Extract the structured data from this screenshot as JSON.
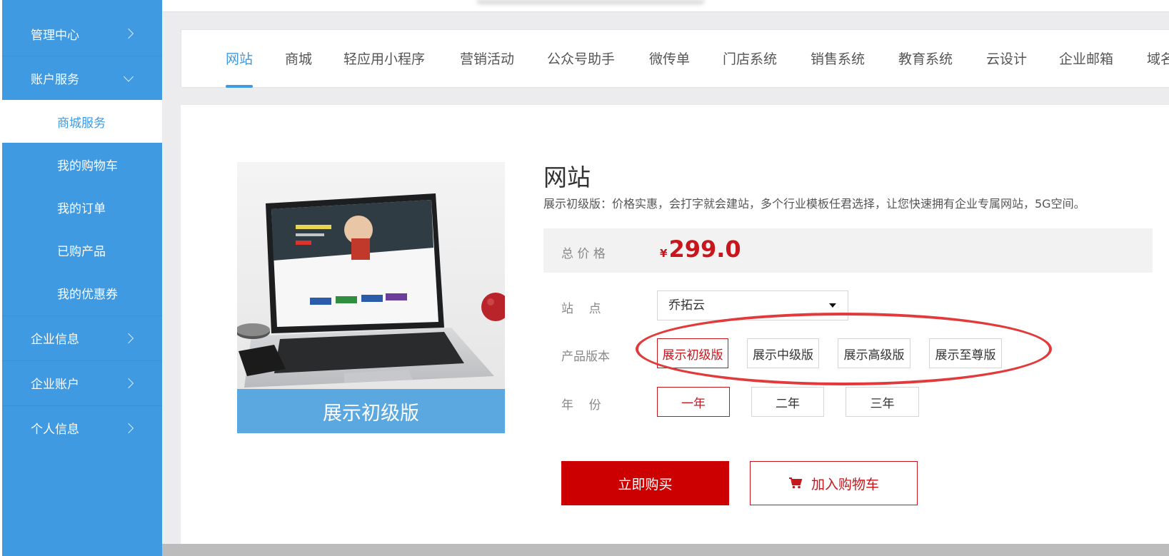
{
  "sidebar": {
    "items": [
      {
        "label": "管理中心"
      },
      {
        "label": "账户服务"
      },
      {
        "label": "企业信息"
      },
      {
        "label": "企业账户"
      },
      {
        "label": "个人信息"
      }
    ],
    "sub_items": [
      {
        "label": "商城服务"
      },
      {
        "label": "我的购物车"
      },
      {
        "label": "我的订单"
      },
      {
        "label": "已购产品"
      },
      {
        "label": "我的优惠券"
      }
    ]
  },
  "tabs": [
    {
      "label": "网站"
    },
    {
      "label": "商城"
    },
    {
      "label": "轻应用小程序"
    },
    {
      "label": "营销活动"
    },
    {
      "label": "公众号助手"
    },
    {
      "label": "微传单"
    },
    {
      "label": "门店系统"
    },
    {
      "label": "销售系统"
    },
    {
      "label": "教育系统"
    },
    {
      "label": "云设计"
    },
    {
      "label": "企业邮箱"
    },
    {
      "label": "域名"
    }
  ],
  "product": {
    "title": "网站",
    "description": "展示初级版：价格实惠，会打字就会建站，多个行业模板任君选择，让您快速拥有企业专属网站，5G空间。",
    "image_caption": "展示初级版",
    "price_label": "总 价 格",
    "currency": "¥",
    "price": "299.0",
    "site_label": "站    点",
    "site_value": "乔拓云",
    "version_label": "产品版本",
    "versions": [
      {
        "label": "展示初级版"
      },
      {
        "label": "展示中级版"
      },
      {
        "label": "展示高级版"
      },
      {
        "label": "展示至尊版"
      }
    ],
    "year_label": "年    份",
    "years": [
      {
        "label": "一年"
      },
      {
        "label": "二年"
      },
      {
        "label": "三年"
      }
    ],
    "buy_label": "立即购买",
    "cart_label": "加入购物车"
  },
  "colors": {
    "sidebar": "#3f9ae1",
    "accent_red": "#c8161d",
    "annotation": "#e23a3a"
  }
}
